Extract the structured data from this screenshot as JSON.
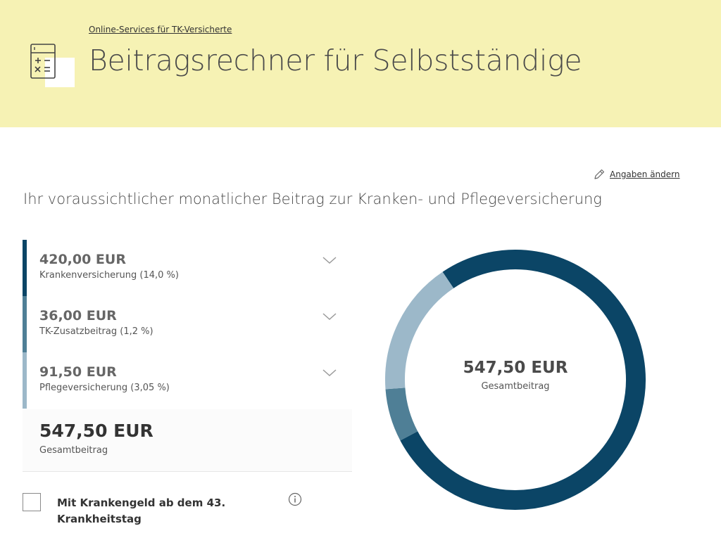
{
  "header": {
    "breadcrumb": "Online-Services für TK-Versicherte",
    "title": "Beitragsrechner für Selbstständige",
    "icon": "calculator-icon"
  },
  "edit_link": {
    "label": "Angaben ändern",
    "icon": "pencil-icon"
  },
  "subtitle": "Ihr voraussichtlicher monatlicher Beitrag zur Kranken- und Pflegeversicherung",
  "items": [
    {
      "amount": "420,00 EUR",
      "label": "Krankenversicherung (14,0 %)",
      "color": "#0b4566"
    },
    {
      "amount": "36,00 EUR",
      "label": "TK-Zusatzbeitrag (1,2 %)",
      "color": "#4f7f96"
    },
    {
      "amount": "91,50 EUR",
      "label": "Pflegeversicherung (3,05 %)",
      "color": "#9cb8c9"
    }
  ],
  "total": {
    "amount": "547,50 EUR",
    "label": "Gesamtbeitrag"
  },
  "checkbox": {
    "label": "Mit Krankengeld ab dem 43. Krankheitstag",
    "checked": false
  },
  "chart_data": {
    "type": "pie",
    "categories": [
      "Krankenversicherung (14,0 %)",
      "TK-Zusatzbeitrag (1,2 %)",
      "Pflegeversicherung (3,05 %)"
    ],
    "values": [
      420.0,
      36.0,
      91.5
    ],
    "colors": [
      "#0b4566",
      "#4f7f96",
      "#9cb8c9"
    ],
    "center_value": "547,50 EUR",
    "center_label": "Gesamtbeitrag"
  }
}
